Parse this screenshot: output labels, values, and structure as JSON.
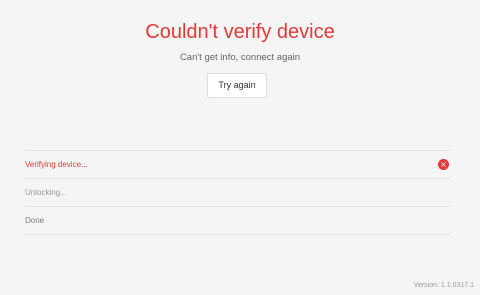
{
  "title": "Couldn't verify device",
  "subtitle": "Can't get info, connect again",
  "retry_label": "Try again",
  "steps": [
    {
      "label": "Verifying device...",
      "state": "error",
      "icon": "error-x-icon"
    },
    {
      "label": "Unlocking...",
      "state": "pending"
    },
    {
      "label": "Done",
      "state": "pending"
    }
  ],
  "version": "Version: 1.1.0317.1",
  "colors": {
    "accent": "#e53935",
    "background": "#f5f5f5"
  }
}
